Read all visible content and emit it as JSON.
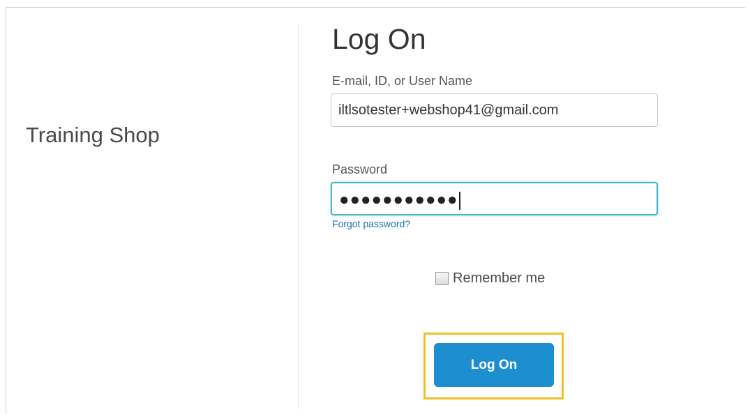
{
  "brand": {
    "name": "Training Shop"
  },
  "login": {
    "title": "Log On",
    "email_label": "E-mail, ID, or User Name",
    "email_value": "iltlsotester+webshop41@gmail.com",
    "password_label": "Password",
    "password_masked": "●●●●●●●●●●●",
    "forgot_link": "Forgot password?",
    "remember_label": "Remember me",
    "remember_checked": false,
    "submit_label": "Log On"
  },
  "colors": {
    "button": "#1d8fd0",
    "highlight": "#f0c02a",
    "focus_border": "#49b6c8",
    "link": "#1a6fb0"
  }
}
